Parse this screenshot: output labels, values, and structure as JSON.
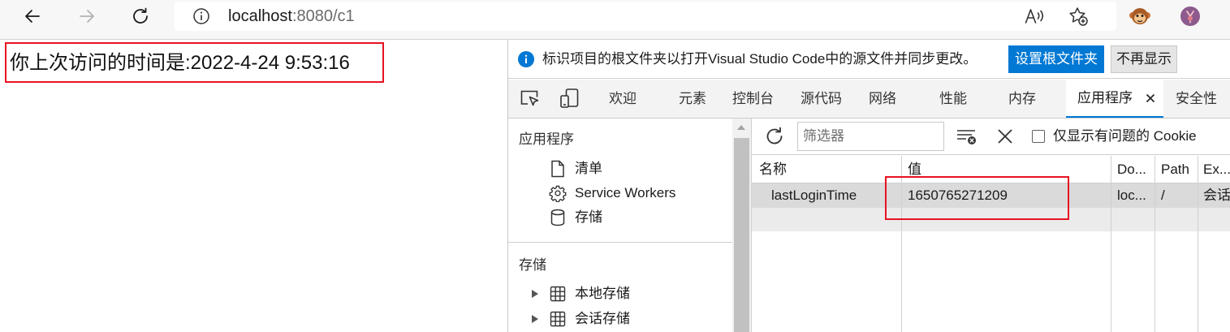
{
  "browser": {
    "url_host": "localhost",
    "url_rest": ":8080/c1",
    "back_icon": "back-arrow-icon",
    "forward_icon": "forward-arrow-icon",
    "refresh_icon": "refresh-icon",
    "site_info_icon": "info-icon",
    "read_aloud_icon": "read-aloud-icon",
    "favorite_icon": "add-favorite-icon",
    "extension_icon": "monkey-extension-icon",
    "profile_icon": "profile-avatar-icon"
  },
  "page": {
    "message": "你上次访问的时间是:2022-4-24 9:53:16"
  },
  "devtools": {
    "infobar": {
      "text": "标识项目的根文件夹以打开Visual Studio Code中的源文件并同步更改。",
      "primary_button": "设置根文件夹",
      "secondary_button": "不再显示"
    },
    "tabs": [
      {
        "label": "欢迎",
        "active": false
      },
      {
        "label": "元素",
        "active": false
      },
      {
        "label": "控制台",
        "active": false
      },
      {
        "label": "源代码",
        "active": false
      },
      {
        "label": "网络",
        "active": false
      },
      {
        "label": "性能",
        "active": false
      },
      {
        "label": "内存",
        "active": false
      },
      {
        "label": "应用程序",
        "active": true
      },
      {
        "label": "安全性",
        "active": false
      }
    ],
    "sidebar": {
      "application": {
        "title": "应用程序",
        "items": [
          {
            "label": "清单",
            "icon": "document-icon"
          },
          {
            "label": "Service Workers",
            "icon": "gear-icon"
          },
          {
            "label": "存储",
            "icon": "database-icon"
          }
        ]
      },
      "storage": {
        "title": "存储",
        "items": [
          {
            "label": "本地存储",
            "icon": "table-grid-icon",
            "expanded": false
          },
          {
            "label": "会话存储",
            "icon": "table-grid-icon",
            "expanded": false
          }
        ]
      }
    },
    "cookies": {
      "filter_placeholder": "筛选器",
      "only_issues_label": "仅显示有问题的 Cookie",
      "only_issues_checked": false,
      "columns": {
        "name": "名称",
        "value": "值",
        "domain": "Do...",
        "path": "Path",
        "expires": "Ex..."
      },
      "rows": [
        {
          "name": "lastLoginTime",
          "value": "1650765271209",
          "domain": "loc...",
          "path": "/",
          "expires": "会话",
          "selected": true
        }
      ]
    }
  },
  "colors": {
    "accent": "#0078d4",
    "highlight_box": "#e81123",
    "selected_row": "#dadada"
  }
}
